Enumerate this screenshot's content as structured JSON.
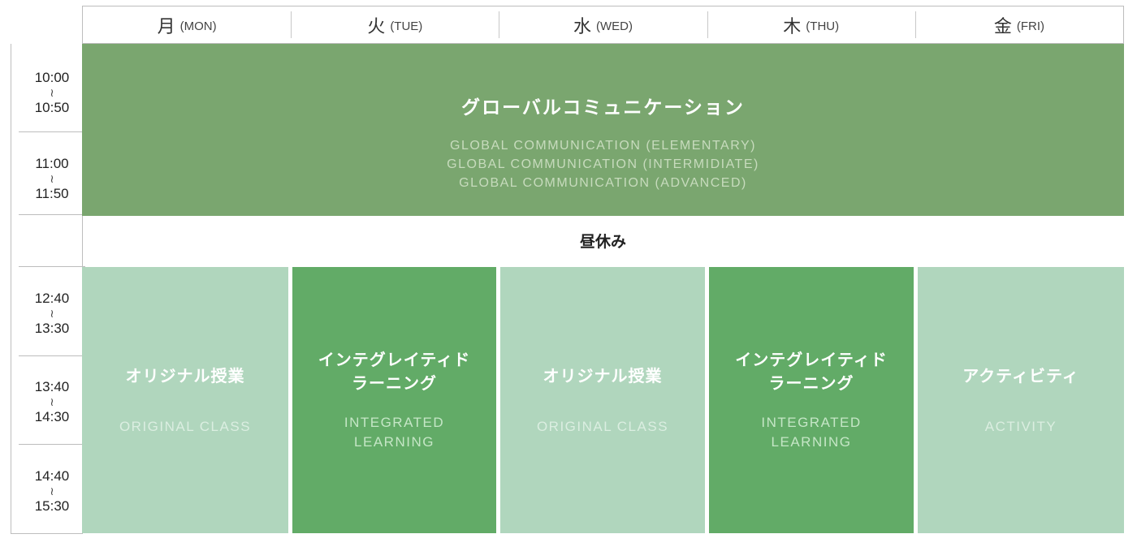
{
  "days": [
    {
      "kanji": "月",
      "en": "(MON)"
    },
    {
      "kanji": "火",
      "en": "(TUE)"
    },
    {
      "kanji": "水",
      "en": "(WED)"
    },
    {
      "kanji": "木",
      "en": "(THU)"
    },
    {
      "kanji": "金",
      "en": "(FRI)"
    }
  ],
  "times": [
    {
      "start": "10:00",
      "sep": "≀",
      "end": "10:50"
    },
    {
      "start": "11:00",
      "sep": "≀",
      "end": "11:50"
    },
    {
      "start": "12:40",
      "sep": "≀",
      "end": "13:30"
    },
    {
      "start": "13:40",
      "sep": "≀",
      "end": "14:30"
    },
    {
      "start": "14:40",
      "sep": "≀",
      "end": "15:30"
    }
  ],
  "morning": {
    "title": "グローバルコミュニケーション",
    "subtitles": [
      "GLOBAL COMMUNICATION (ELEMENTARY)",
      "GLOBAL COMMUNICATION (INTERMIDIATE)",
      "GLOBAL COMMUNICATION (ADVANCED)"
    ]
  },
  "lunch": "昼休み",
  "afternoon": [
    {
      "title": [
        "オリジナル授業"
      ],
      "en": [
        "ORIGINAL CLASS"
      ]
    },
    {
      "title": [
        "インテグレイティド",
        "ラーニング"
      ],
      "en": [
        "INTEGRATED",
        "LEARNING"
      ]
    },
    {
      "title": [
        "オリジナル授業"
      ],
      "en": [
        "ORIGINAL CLASS"
      ]
    },
    {
      "title": [
        "インテグレイティド",
        "ラーニング"
      ],
      "en": [
        "INTEGRATED",
        "LEARNING"
      ]
    },
    {
      "title": [
        "アクティビティ"
      ],
      "en": [
        "ACTIVITY"
      ]
    }
  ],
  "colors": {
    "morning_block": "#7aa66f",
    "light_block": "#b0d6bd",
    "dark_block": "#62ab67"
  }
}
